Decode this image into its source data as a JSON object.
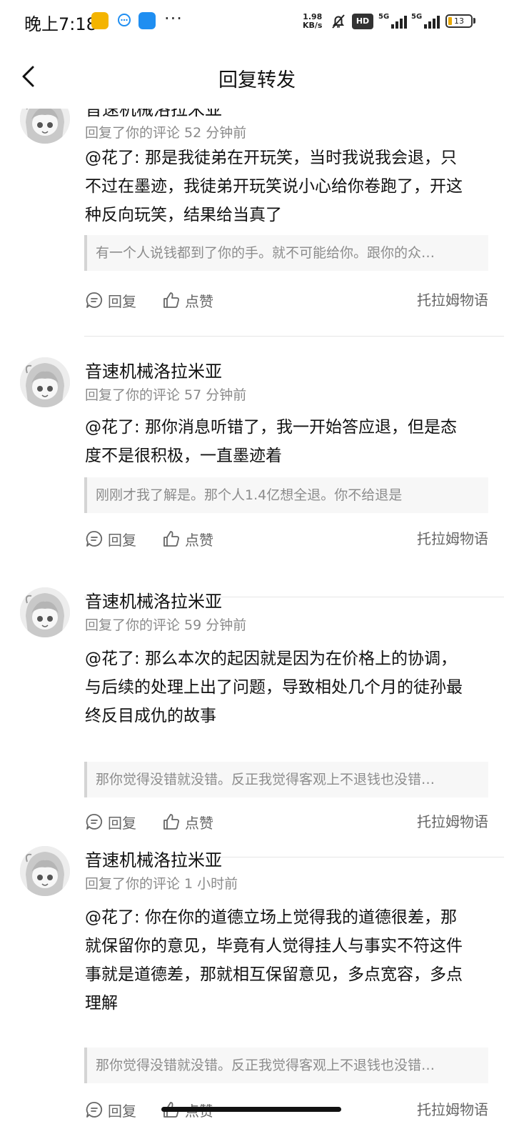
{
  "status_bar": {
    "time": "晚上7:18",
    "more": "···",
    "speed_value": "1.98",
    "speed_unit": "KB/s",
    "hd": "HD",
    "net1": "5G",
    "net2": "5G",
    "battery": "13",
    "icons": [
      "app-notification-icon",
      "chat-bubble-icon",
      "app-blue-icon",
      "bell-muted-icon",
      "signal-icon",
      "battery-icon"
    ]
  },
  "header": {
    "title": "回复转发",
    "back_icon": "chevron-left-icon"
  },
  "items": [
    {
      "username": "音速机械洛拉米亚",
      "meta": "回复了你的评论 52 分钟前",
      "body_lines": [
        "@花了: 那是我徒弟在开玩笑，当时我说我会退，只",
        "不过在墨迹，我徒弟开玩笑说小心给你卷跑了，开这",
        "种反向玩笑，结果给当真了"
      ],
      "quote": "有一个人说钱都到了你的手。就不可能给你。跟你的众…",
      "reply_label": "回复",
      "like_label": "点赞",
      "source": "托拉姆物语"
    },
    {
      "username": "音速机械洛拉米亚",
      "meta": "回复了你的评论 57 分钟前",
      "body_lines": [
        "@花了: 那你消息听错了，我一开始答应退，但是态",
        "度不是很积极，一直墨迹着"
      ],
      "quote": "刚刚才我了解是。那个人1.4亿想全退。你不给退是",
      "reply_label": "回复",
      "like_label": "点赞",
      "source": "托拉姆物语"
    },
    {
      "username": "音速机械洛拉米亚",
      "meta": "回复了你的评论 59 分钟前",
      "body_lines": [
        "@花了: 那么本次的起因就是因为在价格上的协调，",
        "与后续的处理上出了问题，导致相处几个月的徒孙最",
        "终反目成仇的故事"
      ],
      "quote": "那你觉得没错就没错。反正我觉得客观上不退钱也没错…",
      "reply_label": "回复",
      "like_label": "点赞",
      "source": "托拉姆物语"
    },
    {
      "username": "音速机械洛拉米亚",
      "meta": "回复了你的评论 1 小时前",
      "body_lines": [
        "@花了: 你在你的道德立场上觉得我的道德很差，那",
        "就保留你的意见，毕竟有人觉得挂人与事实不符这件",
        "事就是道德差，那就相互保留意见，多点宽容，多点",
        "理解"
      ],
      "quote": "那你觉得没错就没错。反正我觉得客观上不退钱也没错…",
      "reply_label": "回复",
      "like_label": "点赞",
      "source": "托拉姆物语"
    }
  ]
}
